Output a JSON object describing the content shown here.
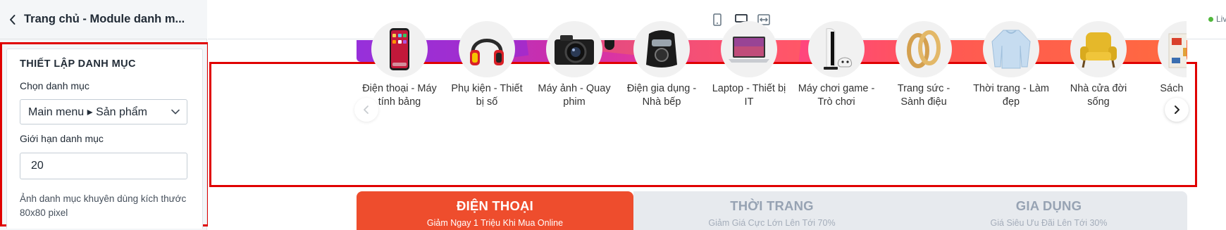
{
  "sidebar": {
    "title": "Trang chủ - Module danh m...",
    "settings": {
      "heading": "THIẾT LẬP DANH MỤC",
      "select_label": "Chọn danh mục",
      "select_value": "Main menu ▸ Sản phẩm",
      "limit_label": "Giới hạn danh mục",
      "limit_value": "20",
      "hint": "Ảnh danh mục khuyên dùng kích thước 80x80 pixel"
    }
  },
  "toolbar": {
    "devices": [
      {
        "name": "mobile",
        "icon": "mobile-icon",
        "active": false
      },
      {
        "name": "desktop",
        "icon": "desktop-icon",
        "active": true
      },
      {
        "name": "full-width",
        "icon": "fullwidth-icon",
        "active": false
      }
    ],
    "status_label": "Liv",
    "accent_color": "#006fbb"
  },
  "categories": [
    {
      "label": "Điện thoại - Máy tính bảng",
      "icon": "phone-icon"
    },
    {
      "label": "Phụ kiện - Thiết bị số",
      "icon": "headphones-icon"
    },
    {
      "label": "Máy ảnh - Quay phim",
      "icon": "camera-icon"
    },
    {
      "label": "Điện gia dụng - Nhà bếp",
      "icon": "air-fryer-icon"
    },
    {
      "label": "Laptop - Thiết bị IT",
      "icon": "laptop-icon"
    },
    {
      "label": "Máy chơi game - Trò chơi",
      "icon": "console-icon"
    },
    {
      "label": "Trang sức - Sành điệu",
      "icon": "rings-icon"
    },
    {
      "label": "Thời trang - Làm đẹp",
      "icon": "sweater-icon"
    },
    {
      "label": "Nhà cửa đời sống",
      "icon": "armchair-icon"
    },
    {
      "label": "Sách - thuy",
      "icon": "books-icon"
    }
  ],
  "tabs": [
    {
      "title": "ĐIỆN THOẠI",
      "subtitle": "Giảm Ngay 1 Triệu Khi Mua Online",
      "active": true
    },
    {
      "title": "THỜI TRANG",
      "subtitle": "Giảm Giá Cực Lớn Lên Tới 70%",
      "active": false
    },
    {
      "title": "GIA DỤNG",
      "subtitle": "Giá Siêu Ưu Đãi Lên Tới 30%",
      "active": false
    }
  ],
  "colors": {
    "highlight_frame": "#e00000",
    "tab_active": "#ee4d2d",
    "tab_inactive": "#e7eaee"
  }
}
